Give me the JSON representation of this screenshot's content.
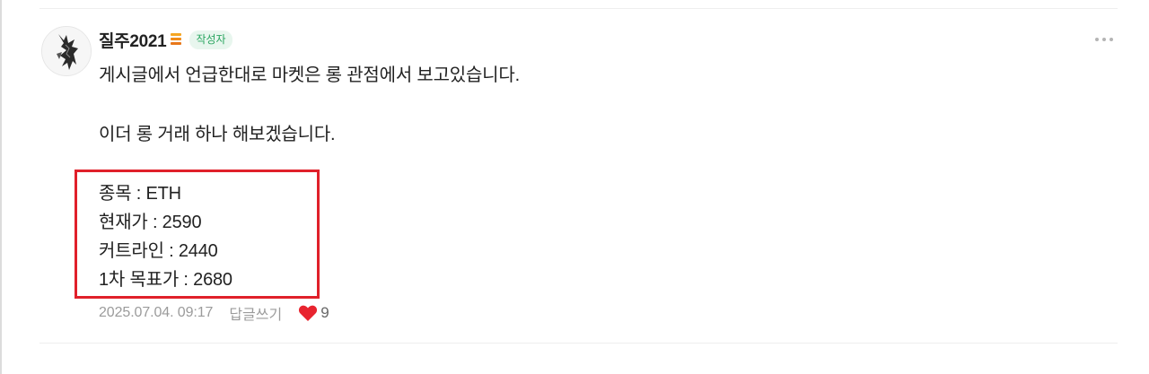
{
  "comment": {
    "author": {
      "name": "질주2021",
      "badge": "작성자",
      "level_icon": "level-icon",
      "avatar_icon": "avatar"
    },
    "content": {
      "line1": "게시글에서 언급한대로 마켓은 롱 관점에서 보고있습니다.",
      "line2": "이더 롱 거래 하나 해보겠습니다.",
      "trade_info": [
        "종목 : ETH",
        "현재가 : 2590",
        "커트라인 : 2440",
        "1차 목표가 : 2680"
      ]
    },
    "meta": {
      "date": "2025.07.04. 09:17",
      "reply_label": "답글쓰기",
      "like_count": "9"
    },
    "colors": {
      "highlight_border": "#e0202a",
      "badge_bg": "#e8f6ee",
      "badge_text": "#2aa560",
      "heart": "#e8242f",
      "meta_text": "#9b9b9b"
    },
    "icons": {
      "more": "more-options-icon",
      "like": "heart-icon"
    }
  }
}
